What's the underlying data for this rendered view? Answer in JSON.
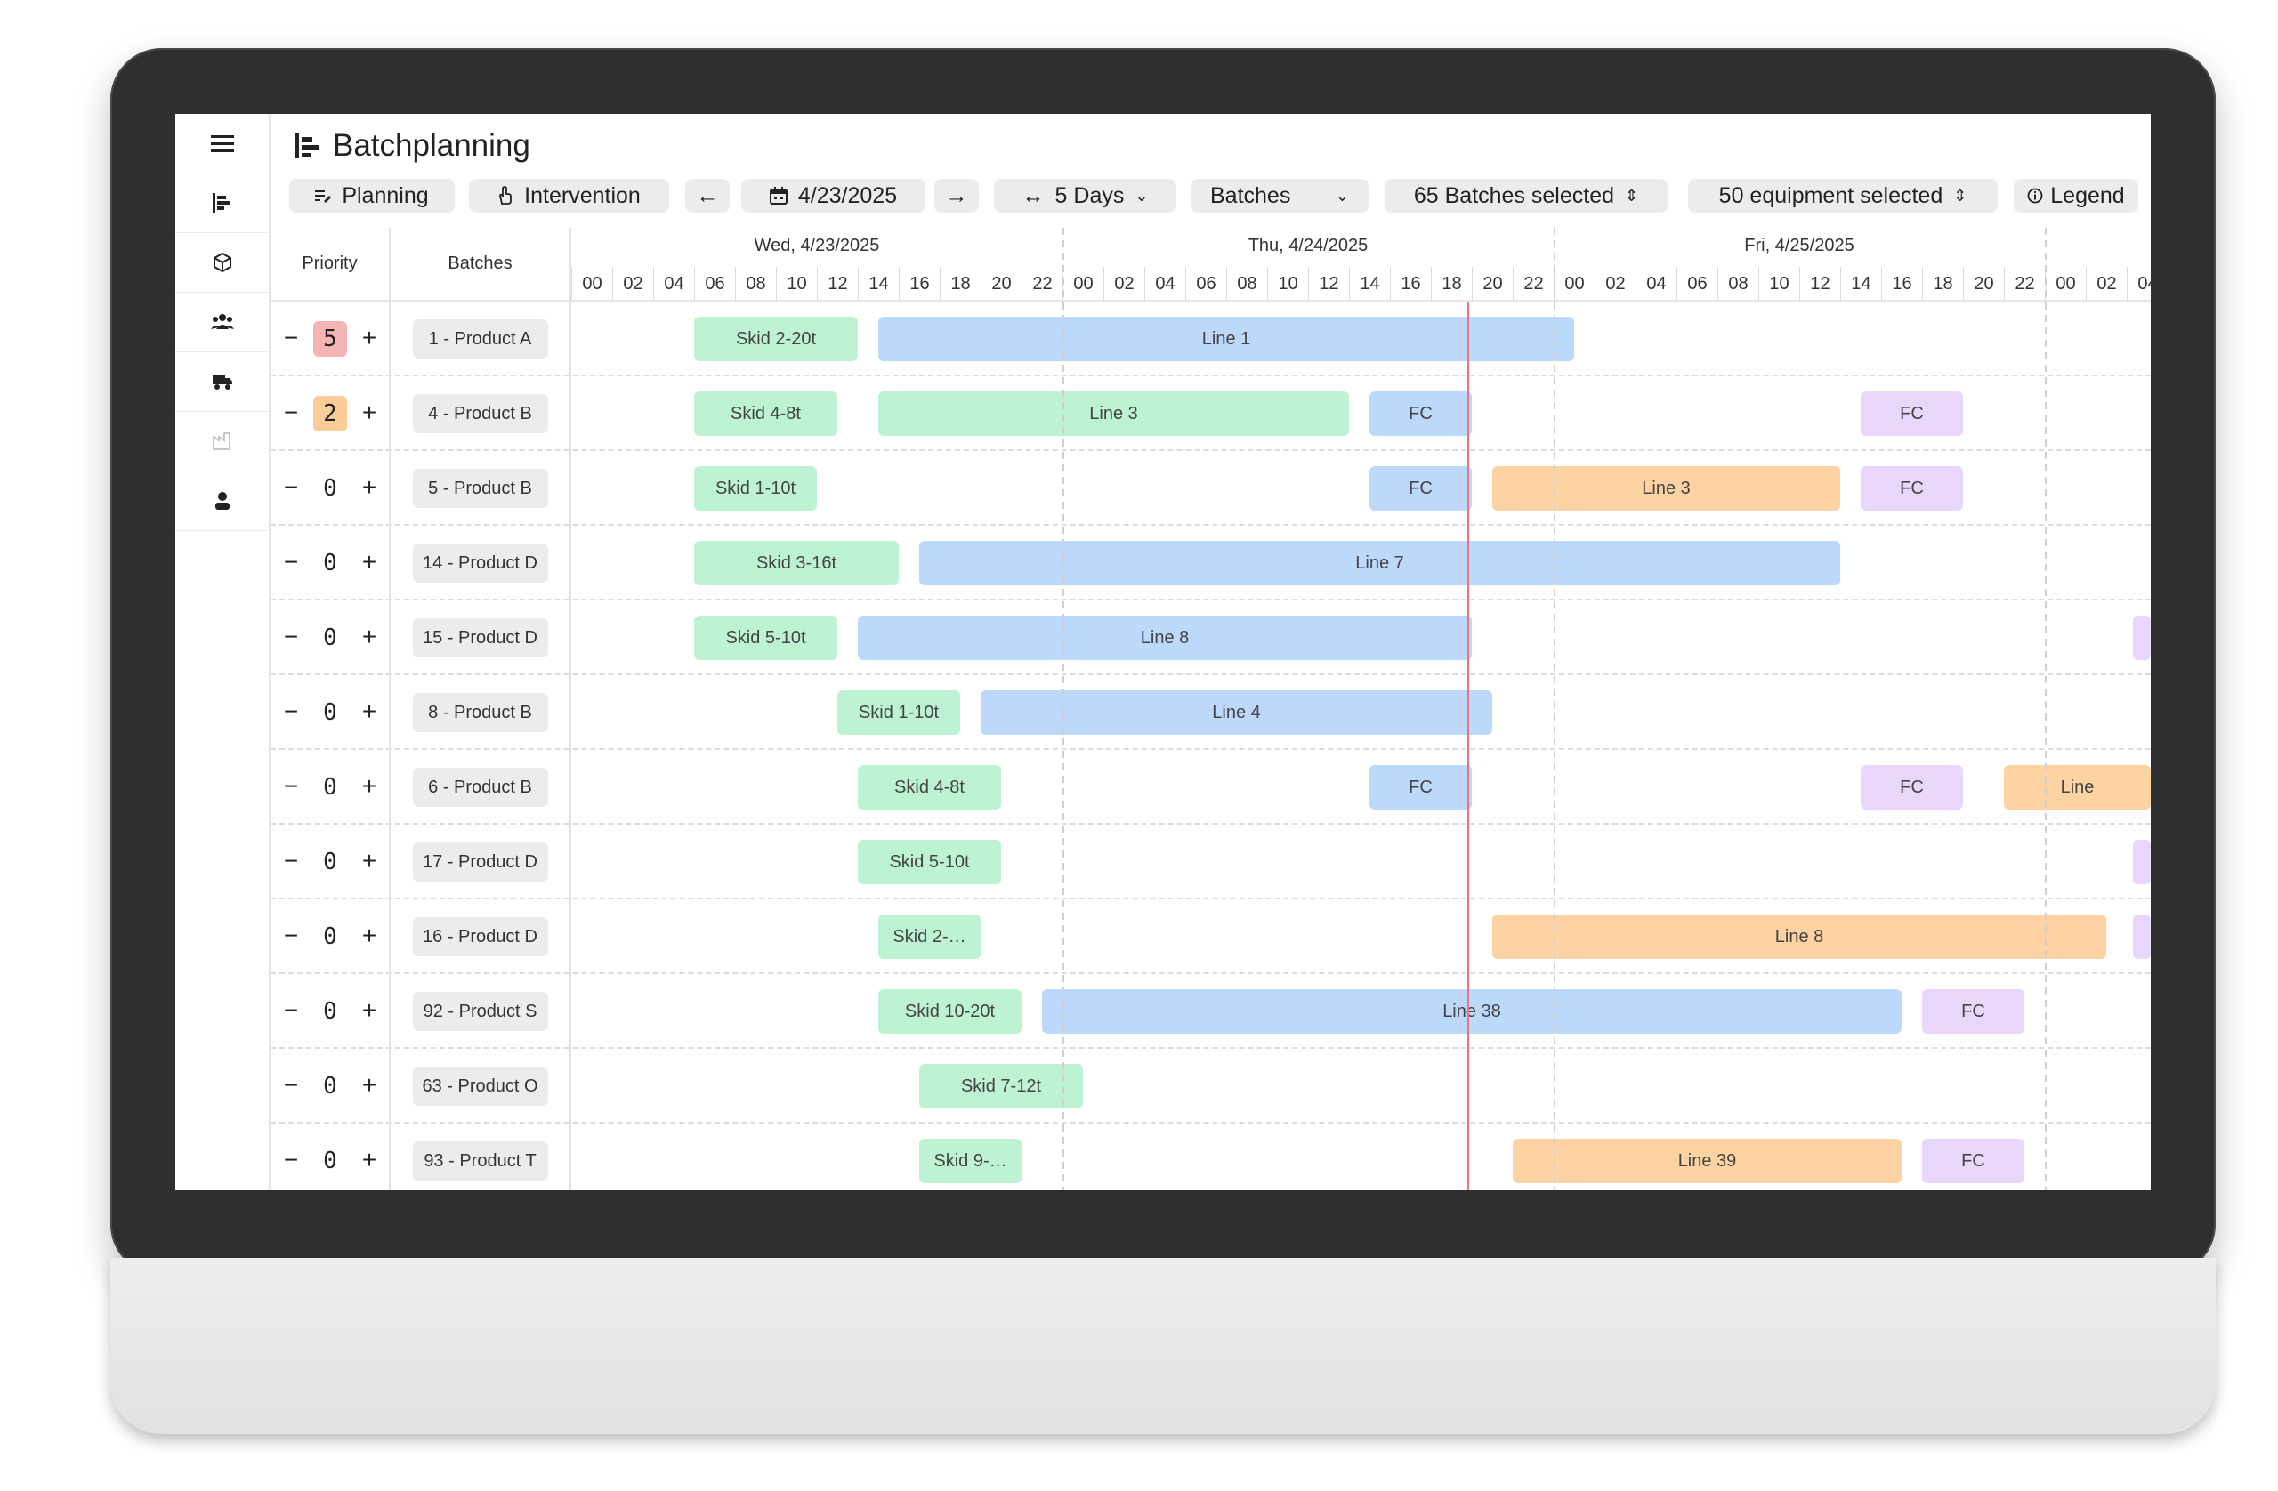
{
  "app": {
    "title": "Batchplanning"
  },
  "toolbar": {
    "planning": "Planning",
    "intervention": "Intervention",
    "prev": "←",
    "date": "4/23/2025",
    "next": "→",
    "range": "5 Days",
    "view": "Batches",
    "batches_selected": "65 Batches selected",
    "equipment_selected": "50 equipment selected",
    "legend": "Legend"
  },
  "grid": {
    "priority_header": "Priority",
    "batches_header": "Batches",
    "days": [
      "Wed, 4/23/2025",
      "Thu, 4/24/2025",
      "Fri, 4/25/2025"
    ],
    "hours": [
      "00",
      "02",
      "04",
      "06",
      "08",
      "10",
      "12",
      "14",
      "16",
      "18",
      "20",
      "22",
      "00",
      "02",
      "04",
      "06",
      "08",
      "10",
      "12",
      "14",
      "16",
      "18",
      "20",
      "22",
      "00",
      "02",
      "04",
      "06",
      "08",
      "10",
      "12",
      "14",
      "16",
      "18",
      "20",
      "22",
      "00",
      "02",
      "04"
    ]
  },
  "colors": {
    "green": "#bdf2d2",
    "blue": "#bcd8fb",
    "orange": "#fdd3a3",
    "purple": "#e8d7fb",
    "now_line": "#e77777"
  },
  "now_hour": 43.8,
  "rows": [
    {
      "priority": "5",
      "level": "high",
      "batch": "1 - Product A",
      "bars": [
        {
          "label": "Skid 2-20t",
          "color": "green",
          "start": 6,
          "end": 14
        },
        {
          "label": "Line 1",
          "color": "blue",
          "start": 15,
          "end": 49
        }
      ]
    },
    {
      "priority": "2",
      "level": "med",
      "batch": "4 - Product B",
      "bars": [
        {
          "label": "Skid 4-8t",
          "color": "green",
          "start": 6,
          "end": 13
        },
        {
          "label": "Line 3",
          "color": "green",
          "start": 15,
          "end": 38
        },
        {
          "label": "FC",
          "color": "blue",
          "start": 39,
          "end": 44
        },
        {
          "label": "FC",
          "color": "purple",
          "start": 63,
          "end": 68
        }
      ]
    },
    {
      "priority": "0",
      "level": "none",
      "batch": "5 - Product B",
      "bars": [
        {
          "label": "Skid 1-10t",
          "color": "green",
          "start": 6,
          "end": 12
        },
        {
          "label": "FC",
          "color": "blue",
          "start": 39,
          "end": 44
        },
        {
          "label": "Line 3",
          "color": "orange",
          "start": 45,
          "end": 62
        },
        {
          "label": "FC",
          "color": "purple",
          "start": 63,
          "end": 68
        }
      ]
    },
    {
      "priority": "0",
      "level": "none",
      "batch": "14 - Product D",
      "bars": [
        {
          "label": "Skid 3-16t",
          "color": "green",
          "start": 6,
          "end": 16
        },
        {
          "label": "Line 7",
          "color": "blue",
          "start": 17,
          "end": 62
        }
      ]
    },
    {
      "priority": "0",
      "level": "none",
      "batch": "15 - Product D",
      "bars": [
        {
          "label": "Skid 5-10t",
          "color": "green",
          "start": 6,
          "end": 13
        },
        {
          "label": "Line 8",
          "color": "blue",
          "start": 14,
          "end": 44
        },
        {
          "label": "",
          "color": "purple",
          "start": 76.3,
          "end": 80
        }
      ]
    },
    {
      "priority": "0",
      "level": "none",
      "batch": "8 - Product B",
      "bars": [
        {
          "label": "Skid 1-10t",
          "color": "green",
          "start": 13,
          "end": 19
        },
        {
          "label": "Line 4",
          "color": "blue",
          "start": 20,
          "end": 45
        }
      ]
    },
    {
      "priority": "0",
      "level": "none",
      "batch": "6 - Product B",
      "bars": [
        {
          "label": "Skid 4-8t",
          "color": "green",
          "start": 14,
          "end": 21
        },
        {
          "label": "FC",
          "color": "blue",
          "start": 39,
          "end": 44
        },
        {
          "label": "FC",
          "color": "purple",
          "start": 63,
          "end": 68
        },
        {
          "label": "Line",
          "color": "orange",
          "start": 70,
          "end": 80
        }
      ]
    },
    {
      "priority": "0",
      "level": "none",
      "batch": "17 - Product D",
      "bars": [
        {
          "label": "Skid 5-10t",
          "color": "green",
          "start": 14,
          "end": 21
        },
        {
          "label": "",
          "color": "purple",
          "start": 76.3,
          "end": 80
        }
      ]
    },
    {
      "priority": "0",
      "level": "none",
      "batch": "16 - Product D",
      "bars": [
        {
          "label": "Skid 2-…",
          "color": "green",
          "start": 15,
          "end": 20
        },
        {
          "label": "Line 8",
          "color": "orange",
          "start": 45,
          "end": 75
        },
        {
          "label": "",
          "color": "purple",
          "start": 76.3,
          "end": 80
        }
      ]
    },
    {
      "priority": "0",
      "level": "none",
      "batch": "92 - Product S",
      "bars": [
        {
          "label": "Skid 10-20t",
          "color": "green",
          "start": 15,
          "end": 22
        },
        {
          "label": "Line 38",
          "color": "blue",
          "start": 23,
          "end": 65
        },
        {
          "label": "FC",
          "color": "purple",
          "start": 66,
          "end": 71
        }
      ]
    },
    {
      "priority": "0",
      "level": "none",
      "batch": "63 - Product O",
      "bars": [
        {
          "label": "Skid 7-12t",
          "color": "green",
          "start": 17,
          "end": 25
        }
      ]
    },
    {
      "priority": "0",
      "level": "none",
      "batch": "93 - Product T",
      "bars": [
        {
          "label": "Skid 9-…",
          "color": "green",
          "start": 17,
          "end": 22
        },
        {
          "label": "Line 39",
          "color": "orange",
          "start": 46,
          "end": 65
        },
        {
          "label": "FC",
          "color": "purple",
          "start": 66,
          "end": 71
        }
      ]
    }
  ]
}
